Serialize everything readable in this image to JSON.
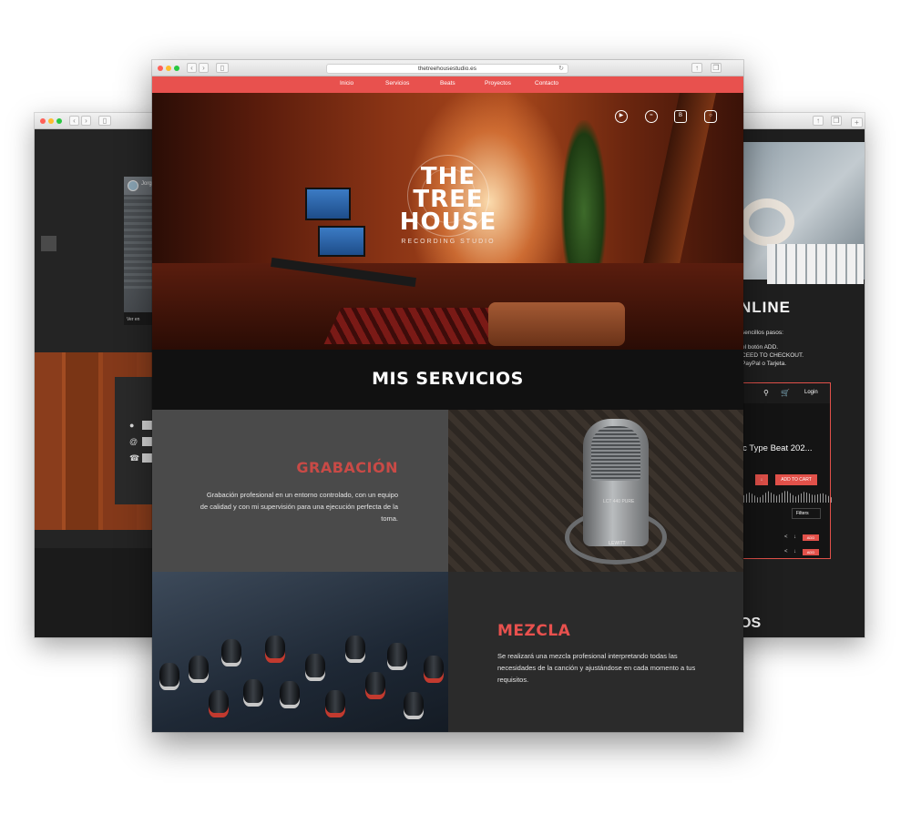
{
  "browser": {
    "url": "thetreehousestudio.es"
  },
  "nav": {
    "items": [
      "Inicio",
      "Servicios",
      "Beats",
      "Proyectos",
      "Contacto"
    ]
  },
  "hero": {
    "logo_line1": "THE",
    "logo_line2": "TREE",
    "logo_line3": "HOUSE",
    "logo_sub": "RECORDING STUDIO",
    "social_icons": [
      "youtube-icon",
      "spotify-icon",
      "bandcamp-icon",
      "instagram-icon"
    ]
  },
  "services": {
    "title": "MIS SERVICIOS",
    "items": [
      {
        "title": "GRABACIÓN",
        "description": "Grabación profesional en un entorno controlado, con un equipo de calidad y con mi supervisión para una ejecución perfecta de la toma."
      },
      {
        "title": "MEZCLA",
        "description": "Se realizará una mezcla profesional interpretando todas las necesidades de la canción y ajustándose en cada momento a tus requisitos."
      }
    ],
    "mic_label": "LCT 440 PURE",
    "mic_brand": "LEWITT"
  },
  "left_window": {
    "video_user": "Jorg",
    "video_label": "Ver en"
  },
  "right_window": {
    "heading_fragment": "NLINE",
    "steps_intro": "sencillos pasos:",
    "steps": [
      "el botón ADD.",
      "CEED TO CHECKOUT.",
      "PayPal o Tarjeta."
    ],
    "login": "Login",
    "beat_title": "ic Type Beat 202...",
    "add_to_cart": "ADD TO CART",
    "filters": "Filters",
    "add": "ADD",
    "bottom_heading_fragment": "OS"
  },
  "colors": {
    "accent": "#e8514e",
    "dark": "#111111",
    "panel": "#4a4a4a",
    "panel_dark": "#2b2b2b"
  }
}
